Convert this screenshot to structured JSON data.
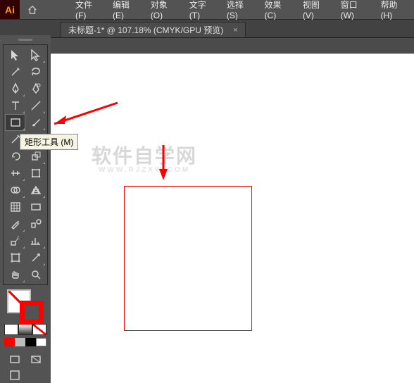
{
  "app": {
    "logo_text": "Ai"
  },
  "menu": {
    "file": "文件(F)",
    "edit": "编辑(E)",
    "object": "对象(O)",
    "type": "文字(T)",
    "select": "选择(S)",
    "effect": "效果(C)",
    "view": "视图(V)",
    "window": "窗口(W)",
    "help": "帮助(H)"
  },
  "tab": {
    "title": "未标题-1* @ 107.18% (CMYK/GPU 预览)",
    "close": "×"
  },
  "tooltip": {
    "rectangle_tool": "矩形工具 (M)"
  },
  "watermark": {
    "line1": "软件自学网",
    "line2": "WWW.RJZXW.COM"
  },
  "colors": {
    "stroke": "#ff0000",
    "row": [
      "#ff0000",
      "#bdbdbd",
      "#000000",
      "#ffffff"
    ]
  },
  "chart_data": null
}
